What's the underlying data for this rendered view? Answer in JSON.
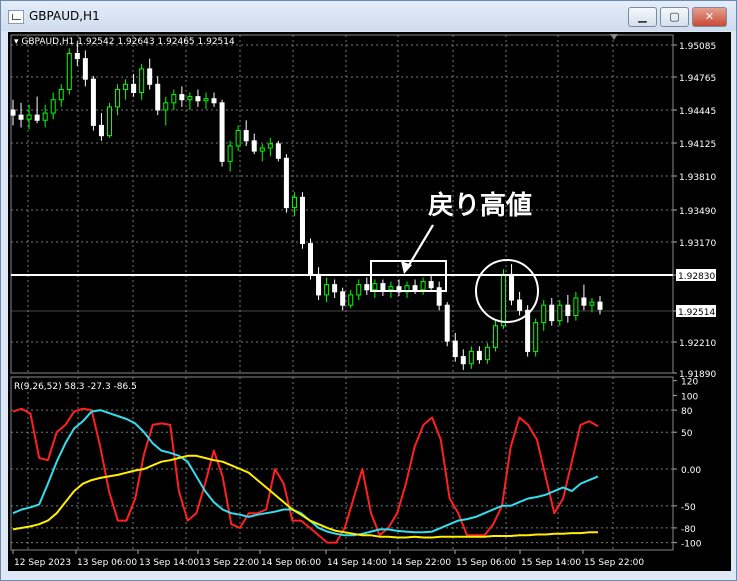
{
  "window": {
    "title": "GBPAUD,H1",
    "minimize": "▁",
    "maximize": "▢",
    "close": "✕"
  },
  "chart": {
    "header": "GBPAUD,H1  1.92542 1.92643 1.92465 1.92514",
    "price_labels": [
      "1.95085",
      "1.94765",
      "1.94445",
      "1.94125",
      "1.93810",
      "1.93490",
      "1.93170",
      "1.92830",
      "1.92514",
      "1.92210",
      "1.91890"
    ],
    "hline_price": "1.92830",
    "current_price": "1.92514",
    "annotation": "戻り高値",
    "colors": {
      "bull": "#00ff00",
      "bear": "#ffffff",
      "hline": "#ffffff",
      "grid": "#7a7a7a"
    }
  },
  "indicator": {
    "header": "R(9,26,52) 58.3 -27.3 -86.5",
    "levels": [
      "120",
      "100",
      "80",
      "50",
      "0.00",
      "-50",
      "-80",
      "-100"
    ],
    "colors": {
      "fast": "#ff2020",
      "mid": "#33ddee",
      "slow": "#ffee00"
    }
  },
  "time_labels": [
    "12 Sep 2023",
    "13 Sep 06:00",
    "13 Sep 14:00",
    "13 Sep 22:00",
    "14 Sep 06:00",
    "14 Sep 14:00",
    "14 Sep 22:00",
    "15 Sep 06:00",
    "15 Sep 14:00",
    "15 Sep 22:00"
  ],
  "chart_data": {
    "type": "candlestick",
    "symbol": "GBPAUD",
    "timeframe": "H1",
    "y_range": [
      1.9189,
      1.9518
    ],
    "candles": [
      {
        "o": 1.9445,
        "h": 1.9455,
        "l": 1.943,
        "c": 1.944
      },
      {
        "o": 1.944,
        "h": 1.9452,
        "l": 1.9428,
        "c": 1.9436
      },
      {
        "o": 1.9436,
        "h": 1.945,
        "l": 1.9426,
        "c": 1.944
      },
      {
        "o": 1.944,
        "h": 1.9458,
        "l": 1.9432,
        "c": 1.9435
      },
      {
        "o": 1.9435,
        "h": 1.945,
        "l": 1.9428,
        "c": 1.9442
      },
      {
        "o": 1.9442,
        "h": 1.9462,
        "l": 1.9436,
        "c": 1.9455
      },
      {
        "o": 1.9455,
        "h": 1.947,
        "l": 1.9448,
        "c": 1.9465
      },
      {
        "o": 1.9465,
        "h": 1.9505,
        "l": 1.946,
        "c": 1.95
      },
      {
        "o": 1.95,
        "h": 1.9512,
        "l": 1.9488,
        "c": 1.9495
      },
      {
        "o": 1.9495,
        "h": 1.9503,
        "l": 1.9468,
        "c": 1.9475
      },
      {
        "o": 1.9475,
        "h": 1.9478,
        "l": 1.9425,
        "c": 1.943
      },
      {
        "o": 1.943,
        "h": 1.9442,
        "l": 1.9415,
        "c": 1.942
      },
      {
        "o": 1.942,
        "h": 1.9452,
        "l": 1.9418,
        "c": 1.9448
      },
      {
        "o": 1.9448,
        "h": 1.947,
        "l": 1.944,
        "c": 1.9465
      },
      {
        "o": 1.9465,
        "h": 1.9475,
        "l": 1.9455,
        "c": 1.947
      },
      {
        "o": 1.947,
        "h": 1.948,
        "l": 1.9458,
        "c": 1.9462
      },
      {
        "o": 1.9462,
        "h": 1.949,
        "l": 1.9455,
        "c": 1.9485
      },
      {
        "o": 1.9485,
        "h": 1.9495,
        "l": 1.9465,
        "c": 1.947
      },
      {
        "o": 1.947,
        "h": 1.9478,
        "l": 1.944,
        "c": 1.9445
      },
      {
        "o": 1.9445,
        "h": 1.9458,
        "l": 1.943,
        "c": 1.9452
      },
      {
        "o": 1.9452,
        "h": 1.9465,
        "l": 1.9445,
        "c": 1.946
      },
      {
        "o": 1.946,
        "h": 1.9468,
        "l": 1.9448,
        "c": 1.9455
      },
      {
        "o": 1.9455,
        "h": 1.9462,
        "l": 1.9445,
        "c": 1.9458
      },
      {
        "o": 1.9458,
        "h": 1.9465,
        "l": 1.9448,
        "c": 1.9454
      },
      {
        "o": 1.9454,
        "h": 1.9462,
        "l": 1.9446,
        "c": 1.9456
      },
      {
        "o": 1.9456,
        "h": 1.9462,
        "l": 1.9448,
        "c": 1.9452
      },
      {
        "o": 1.9452,
        "h": 1.9455,
        "l": 1.939,
        "c": 1.9395
      },
      {
        "o": 1.9395,
        "h": 1.9415,
        "l": 1.9385,
        "c": 1.941
      },
      {
        "o": 1.941,
        "h": 1.943,
        "l": 1.9405,
        "c": 1.9425
      },
      {
        "o": 1.9425,
        "h": 1.9435,
        "l": 1.941,
        "c": 1.9415
      },
      {
        "o": 1.9415,
        "h": 1.9422,
        "l": 1.9402,
        "c": 1.9405
      },
      {
        "o": 1.9405,
        "h": 1.9412,
        "l": 1.9395,
        "c": 1.9408
      },
      {
        "o": 1.9408,
        "h": 1.9418,
        "l": 1.94,
        "c": 1.9412
      },
      {
        "o": 1.9412,
        "h": 1.9415,
        "l": 1.9395,
        "c": 1.9398
      },
      {
        "o": 1.9398,
        "h": 1.9402,
        "l": 1.9345,
        "c": 1.935
      },
      {
        "o": 1.935,
        "h": 1.9365,
        "l": 1.9342,
        "c": 1.936
      },
      {
        "o": 1.936,
        "h": 1.9365,
        "l": 1.931,
        "c": 1.9315
      },
      {
        "o": 1.9315,
        "h": 1.932,
        "l": 1.928,
        "c": 1.9285
      },
      {
        "o": 1.9285,
        "h": 1.9292,
        "l": 1.926,
        "c": 1.9265
      },
      {
        "o": 1.9265,
        "h": 1.9282,
        "l": 1.9258,
        "c": 1.9275
      },
      {
        "o": 1.9275,
        "h": 1.928,
        "l": 1.9262,
        "c": 1.9268
      },
      {
        "o": 1.9268,
        "h": 1.9272,
        "l": 1.925,
        "c": 1.9255
      },
      {
        "o": 1.9255,
        "h": 1.927,
        "l": 1.9252,
        "c": 1.9265
      },
      {
        "o": 1.9265,
        "h": 1.928,
        "l": 1.926,
        "c": 1.9275
      },
      {
        "o": 1.9275,
        "h": 1.9282,
        "l": 1.9265,
        "c": 1.927
      },
      {
        "o": 1.927,
        "h": 1.928,
        "l": 1.9262,
        "c": 1.9276
      },
      {
        "o": 1.9276,
        "h": 1.928,
        "l": 1.9264,
        "c": 1.927
      },
      {
        "o": 1.927,
        "h": 1.9278,
        "l": 1.9262,
        "c": 1.9273
      },
      {
        "o": 1.9273,
        "h": 1.928,
        "l": 1.9264,
        "c": 1.9268
      },
      {
        "o": 1.9268,
        "h": 1.9278,
        "l": 1.9262,
        "c": 1.9274
      },
      {
        "o": 1.9274,
        "h": 1.928,
        "l": 1.9266,
        "c": 1.927
      },
      {
        "o": 1.927,
        "h": 1.9282,
        "l": 1.9265,
        "c": 1.9278
      },
      {
        "o": 1.9278,
        "h": 1.9285,
        "l": 1.927,
        "c": 1.9272
      },
      {
        "o": 1.9272,
        "h": 1.9278,
        "l": 1.925,
        "c": 1.9255
      },
      {
        "o": 1.9255,
        "h": 1.9258,
        "l": 1.9215,
        "c": 1.922
      },
      {
        "o": 1.922,
        "h": 1.9228,
        "l": 1.92,
        "c": 1.9205
      },
      {
        "o": 1.9205,
        "h": 1.9212,
        "l": 1.9192,
        "c": 1.9198
      },
      {
        "o": 1.9198,
        "h": 1.9215,
        "l": 1.9193,
        "c": 1.921
      },
      {
        "o": 1.921,
        "h": 1.9215,
        "l": 1.9198,
        "c": 1.9202
      },
      {
        "o": 1.9202,
        "h": 1.9218,
        "l": 1.9198,
        "c": 1.9214
      },
      {
        "o": 1.9214,
        "h": 1.924,
        "l": 1.921,
        "c": 1.9235
      },
      {
        "o": 1.9235,
        "h": 1.929,
        "l": 1.9232,
        "c": 1.9285
      },
      {
        "o": 1.9285,
        "h": 1.9295,
        "l": 1.9255,
        "c": 1.926
      },
      {
        "o": 1.926,
        "h": 1.9268,
        "l": 1.9245,
        "c": 1.925
      },
      {
        "o": 1.925,
        "h": 1.9255,
        "l": 1.9205,
        "c": 1.921
      },
      {
        "o": 1.921,
        "h": 1.9242,
        "l": 1.9205,
        "c": 1.9238
      },
      {
        "o": 1.9238,
        "h": 1.926,
        "l": 1.923,
        "c": 1.9255
      },
      {
        "o": 1.9255,
        "h": 1.9262,
        "l": 1.9235,
        "c": 1.924
      },
      {
        "o": 1.924,
        "h": 1.926,
        "l": 1.9235,
        "c": 1.9255
      },
      {
        "o": 1.9255,
        "h": 1.9265,
        "l": 1.9238,
        "c": 1.9245
      },
      {
        "o": 1.9245,
        "h": 1.9268,
        "l": 1.924,
        "c": 1.9262
      },
      {
        "o": 1.9262,
        "h": 1.9275,
        "l": 1.925,
        "c": 1.9255
      },
      {
        "o": 1.9255,
        "h": 1.9262,
        "l": 1.9248,
        "c": 1.9258
      },
      {
        "o": 1.9258,
        "h": 1.9264,
        "l": 1.9246,
        "c": 1.9251
      }
    ],
    "indicator_series": [
      {
        "name": "fast",
        "values": [
          78,
          82,
          75,
          15,
          12,
          50,
          60,
          78,
          82,
          80,
          30,
          -30,
          -70,
          -70,
          -40,
          20,
          60,
          62,
          60,
          -30,
          -70,
          -60,
          -20,
          25,
          -10,
          -75,
          -80,
          -60,
          -60,
          -55,
          0,
          -20,
          -70,
          -70,
          -80,
          -90,
          -100,
          -100,
          -80,
          -40,
          0,
          -60,
          -90,
          -80,
          -60,
          -20,
          30,
          60,
          70,
          40,
          -40,
          -60,
          -90,
          -90,
          -90,
          -75,
          -50,
          30,
          70,
          60,
          40,
          -10,
          -60,
          -40,
          10,
          60,
          65,
          58
        ]
      },
      {
        "name": "mid",
        "values": [
          -60,
          -55,
          -52,
          -48,
          -20,
          10,
          35,
          55,
          65,
          78,
          80,
          76,
          72,
          68,
          62,
          50,
          35,
          25,
          22,
          18,
          10,
          -10,
          -30,
          -45,
          -55,
          -60,
          -62,
          -65,
          -62,
          -60,
          -58,
          -55,
          -55,
          -60,
          -70,
          -80,
          -85,
          -88,
          -90,
          -90,
          -88,
          -85,
          -82,
          -82,
          -84,
          -85,
          -86,
          -86,
          -85,
          -80,
          -75,
          -70,
          -68,
          -65,
          -60,
          -55,
          -50,
          -50,
          -45,
          -40,
          -38,
          -35,
          -30,
          -25,
          -30,
          -20,
          -15,
          -10
        ]
      },
      {
        "name": "slow",
        "values": [
          -82,
          -80,
          -78,
          -75,
          -70,
          -60,
          -45,
          -30,
          -20,
          -15,
          -12,
          -10,
          -8,
          -5,
          -2,
          0,
          5,
          10,
          12,
          15,
          18,
          18,
          15,
          12,
          10,
          5,
          0,
          -5,
          -15,
          -25,
          -35,
          -45,
          -55,
          -62,
          -70,
          -75,
          -80,
          -84,
          -86,
          -88,
          -90,
          -90,
          -92,
          -92,
          -93,
          -93,
          -92,
          -93,
          -93,
          -92,
          -92,
          -92,
          -92,
          -92,
          -92,
          -91,
          -91,
          -91,
          -90,
          -90,
          -89,
          -89,
          -88,
          -88,
          -87,
          -87,
          -86,
          -86
        ]
      }
    ],
    "indicator_range": [
      -110,
      125
    ]
  }
}
